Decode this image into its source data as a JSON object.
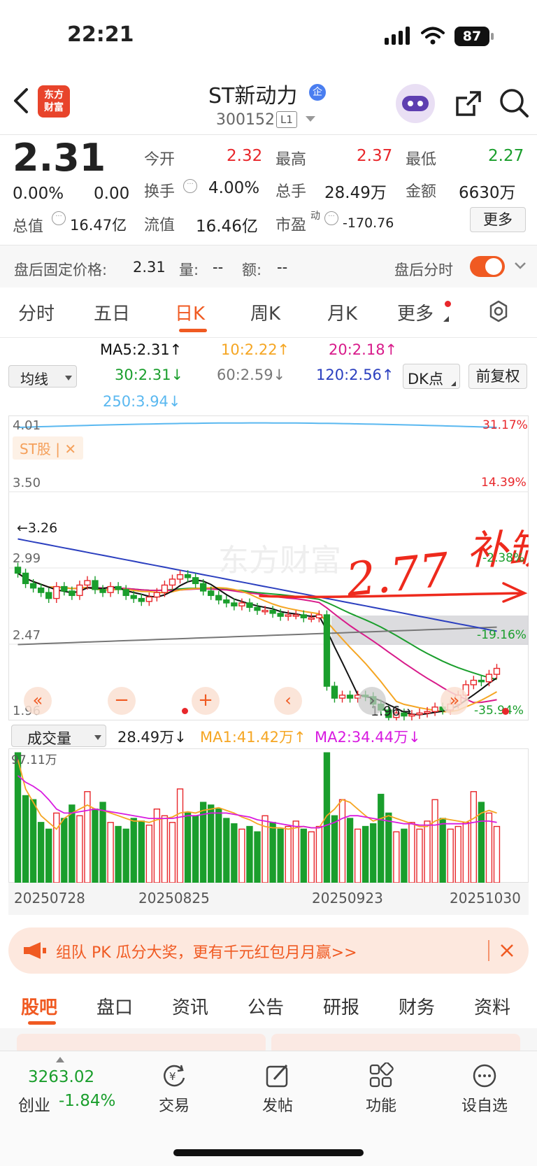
{
  "status_bar": {
    "time": "22:21",
    "battery": "87"
  },
  "header": {
    "logo_text": "东方\n财富",
    "title": "ST新动力",
    "badge": "企",
    "code": "300152",
    "level": "L1"
  },
  "quote": {
    "price": "2.31",
    "change_pct": "0.00%",
    "change": "0.00",
    "open_label": "今开",
    "open": "2.32",
    "high_label": "最高",
    "high": "2.37",
    "low_label": "最低",
    "low": "2.27",
    "turnover_label": "换手",
    "turnover": "4.00%",
    "volume_label": "总手",
    "volume": "28.49万",
    "amount_label": "金额",
    "amount": "6630万",
    "mktcap_label": "总值",
    "mktcap": "16.47亿",
    "float_label": "流值",
    "float": "16.46亿",
    "pe_label": "市盈",
    "pe_sup": "动",
    "pe": "-170.76",
    "more_button": "更多"
  },
  "after_hours": {
    "price_label": "盘后固定价格:",
    "price": "2.31",
    "vol_label": "量:",
    "vol": "--",
    "amt_label": "额:",
    "amt": "--",
    "toggle_label": "盘后分时",
    "toggle_on": true
  },
  "tabs": [
    "分时",
    "五日",
    "日K",
    "周K",
    "月K",
    "更多"
  ],
  "ma": {
    "selector": "均线",
    "ma5": "MA5:2.31↑",
    "ma10": "10:2.22↑",
    "ma20": "20:2.18↑",
    "ma30": "30:2.31↓",
    "ma60": "60:2.59↓",
    "ma120": "120:2.56↑",
    "ma250": "250:3.94↓",
    "dk_button": "DK点",
    "adjust_button": "前复权"
  },
  "chart_labels": {
    "y_top": "4.01",
    "pct_top": "31.17%",
    "st_tag": "ST股 | ✕",
    "y_2": "3.50",
    "pct_2": "14.39%",
    "max_marker": "←3.26",
    "y_3": "2.99",
    "pct_3": "-2.38%",
    "y_4": "2.47",
    "pct_4": "-19.16%",
    "y_bottom": "1.96",
    "pct_bottom": "-35.94%",
    "min_marker": "1.96→",
    "watermark": "东方财富",
    "handwriting_number": "2.77",
    "handwriting_text": "补缺"
  },
  "volume": {
    "selector": "成交量",
    "value": "28.49万↓",
    "ma1": "MA1:41.42万↑",
    "ma2": "MA2:34.44万↓",
    "max_label": "97.11万"
  },
  "dates": [
    "20250728",
    "20250825",
    "20250923",
    "20251030"
  ],
  "colors": {
    "up": "#e8272b",
    "down": "#1a9e2c",
    "accent": "#f05a22"
  },
  "banner": {
    "text": "组队 PK 瓜分大奖，更有千元红包月月赢>>"
  },
  "bottom_tabs": [
    "股吧",
    "盘口",
    "资讯",
    "公告",
    "研报",
    "财务",
    "资料"
  ],
  "dock": {
    "index_value": "3263.02",
    "index_name": "创业",
    "index_change": "-1.84%",
    "trade": "交易",
    "post": "发帖",
    "functions": "功能",
    "watchlist": "设自选"
  },
  "chart_data": {
    "type": "candlestick",
    "ylim": [
      1.96,
      4.01
    ],
    "y_ticks": [
      4.01,
      3.5,
      2.99,
      2.47,
      1.96
    ],
    "pct_ticks": [
      "31.17%",
      "14.39%",
      "-2.38%",
      "-19.16%",
      "-35.94%"
    ],
    "x_tick_labels": [
      "20250728",
      "20250825",
      "20250923",
      "20251030"
    ],
    "max_marker": 3.26,
    "min_marker": 1.96,
    "close": [
      2.95,
      2.88,
      2.85,
      2.82,
      2.78,
      2.86,
      2.83,
      2.8,
      2.87,
      2.9,
      2.84,
      2.82,
      2.86,
      2.84,
      2.8,
      2.78,
      2.76,
      2.79,
      2.82,
      2.87,
      2.91,
      2.94,
      2.92,
      2.88,
      2.83,
      2.8,
      2.77,
      2.75,
      2.73,
      2.75,
      2.72,
      2.7,
      2.7,
      2.68,
      2.66,
      2.67,
      2.67,
      2.65,
      2.65,
      2.67,
      2.19,
      2.11,
      2.13,
      2.11,
      2.13,
      2.12,
      2.07,
      2.03,
      1.98,
      2.01,
      1.99,
      2.0,
      2.01,
      2.02,
      2.05,
      2.03,
      2.07,
      2.13,
      2.2,
      2.23,
      2.22,
      2.27,
      2.31
    ],
    "volume_wan": [
      97,
      65,
      62,
      45,
      40,
      52,
      48,
      58,
      50,
      68,
      55,
      60,
      45,
      42,
      40,
      48,
      46,
      43,
      55,
      50,
      45,
      70,
      52,
      50,
      60,
      58,
      55,
      48,
      44,
      40,
      42,
      38,
      50,
      45,
      40,
      42,
      46,
      40,
      38,
      42,
      97,
      50,
      62,
      48,
      40,
      42,
      44,
      66,
      52,
      38,
      40,
      45,
      40,
      46,
      62,
      48,
      40,
      42,
      45,
      68,
      60,
      52,
      42
    ],
    "volume_ma1_wan": [
      92,
      70,
      60,
      50,
      45,
      40,
      48,
      52,
      55,
      58,
      55,
      54,
      52,
      50,
      48,
      46,
      46,
      45,
      47,
      48,
      49,
      52,
      53,
      52,
      54,
      55,
      56,
      54,
      52,
      49,
      47,
      44,
      42,
      41,
      41,
      40,
      41,
      42,
      41,
      41,
      50,
      55,
      62,
      60,
      55,
      50,
      46,
      48,
      50,
      48,
      46,
      44,
      42,
      42,
      46,
      48,
      47,
      46,
      45,
      48,
      52,
      54,
      52
    ],
    "volume_ma2_wan": [
      80,
      75,
      72,
      68,
      62,
      55,
      52,
      52,
      53,
      54,
      55,
      54,
      53,
      52,
      51,
      50,
      49,
      48,
      48,
      48,
      48,
      49,
      50,
      50,
      51,
      52,
      52,
      52,
      51,
      50,
      49,
      47,
      46,
      45,
      44,
      43,
      42,
      42,
      41,
      41,
      43,
      45,
      48,
      50,
      50,
      49,
      48,
      47,
      46,
      45,
      44,
      44,
      43,
      43,
      43,
      44,
      44,
      44,
      44,
      45,
      46,
      46,
      45
    ]
  }
}
